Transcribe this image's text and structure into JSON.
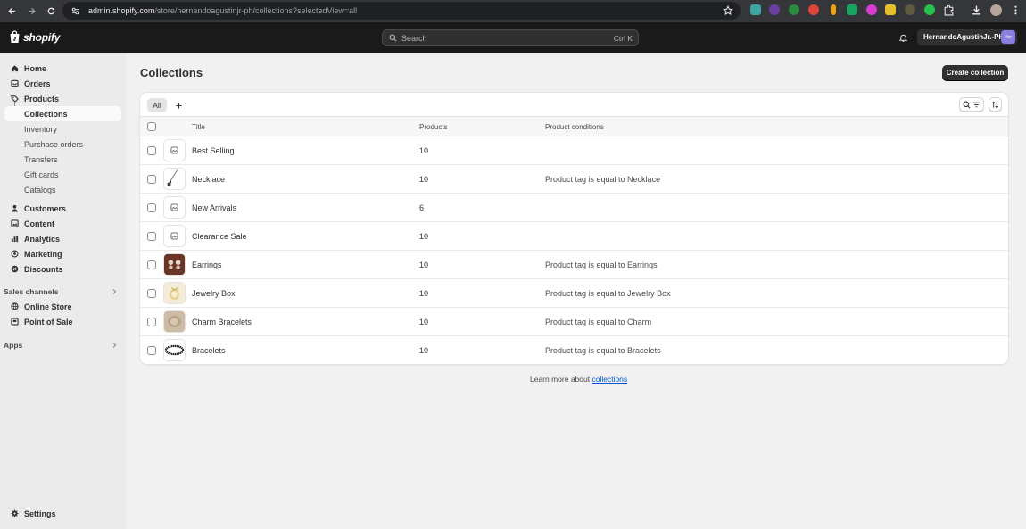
{
  "browser": {
    "url_host": "admin.shopify.com",
    "url_path": "/store/hernandoagustinjr-ph/collections?selectedView=all"
  },
  "header": {
    "logo_text": "shopify",
    "search_placeholder": "Search",
    "search_shortcut": "Ctrl K",
    "account_name": "HernandoAgustinJr.-PH",
    "account_avatar": "Her"
  },
  "sidebar": {
    "items": [
      {
        "label": "Home",
        "icon": "home-icon"
      },
      {
        "label": "Orders",
        "icon": "orders-icon"
      },
      {
        "label": "Products",
        "icon": "tag-icon"
      },
      {
        "label": "Collections"
      },
      {
        "label": "Inventory"
      },
      {
        "label": "Purchase orders"
      },
      {
        "label": "Transfers"
      },
      {
        "label": "Gift cards"
      },
      {
        "label": "Catalogs"
      },
      {
        "label": "Customers",
        "icon": "person-icon"
      },
      {
        "label": "Content",
        "icon": "content-icon"
      },
      {
        "label": "Analytics",
        "icon": "analytics-icon"
      },
      {
        "label": "Marketing",
        "icon": "marketing-icon"
      },
      {
        "label": "Discounts",
        "icon": "discount-icon"
      }
    ],
    "sales_channels_label": "Sales channels",
    "channels": [
      {
        "label": "Online Store",
        "icon": "store-icon"
      },
      {
        "label": "Point of Sale",
        "icon": "pos-icon"
      }
    ],
    "apps_label": "Apps",
    "settings_label": "Settings"
  },
  "main": {
    "title": "Collections",
    "create_button": "Create collection",
    "tab_all": "All",
    "columns": {
      "title": "Title",
      "products": "Products",
      "conditions": "Product conditions"
    },
    "rows": [
      {
        "title": "Best Selling",
        "products": "10",
        "conditions": ""
      },
      {
        "title": "Necklace",
        "products": "10",
        "conditions": "Product tag is equal to Necklace"
      },
      {
        "title": "New Arrivals",
        "products": "6",
        "conditions": ""
      },
      {
        "title": "Clearance Sale",
        "products": "10",
        "conditions": ""
      },
      {
        "title": "Earrings",
        "products": "10",
        "conditions": "Product tag is equal to Earrings"
      },
      {
        "title": "Jewelry Box",
        "products": "10",
        "conditions": "Product tag is equal to Jewelry Box"
      },
      {
        "title": "Charm Bracelets",
        "products": "10",
        "conditions": "Product tag is equal to Charm"
      },
      {
        "title": "Bracelets",
        "products": "10",
        "conditions": "Product tag is equal to Bracelets"
      }
    ],
    "learn_more_prefix": "Learn more about ",
    "learn_more_link": "collections"
  }
}
